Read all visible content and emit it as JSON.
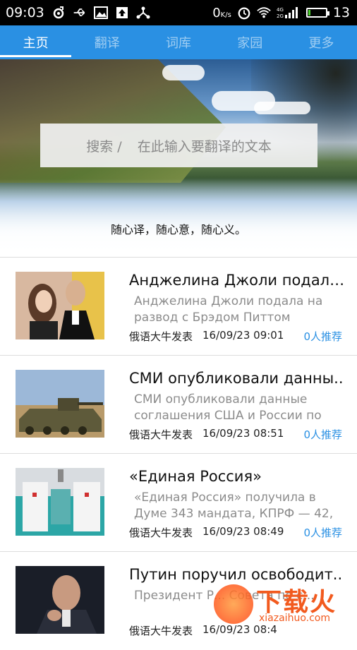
{
  "status_bar": {
    "time": "09:03",
    "net_speed": "0",
    "net_speed_unit": "K/s",
    "battery_level": "13",
    "icons": [
      "weibo-icon",
      "usb-icon",
      "image-icon",
      "upload-icon",
      "share-icon",
      "alarm-icon",
      "wifi-icon",
      "signal-icon",
      "battery-icon"
    ]
  },
  "tabs": [
    {
      "label": "主页",
      "active": true
    },
    {
      "label": "翻译",
      "active": false
    },
    {
      "label": "词库",
      "active": false
    },
    {
      "label": "家园",
      "active": false
    },
    {
      "label": "更多",
      "active": false
    }
  ],
  "hero": {
    "search_prefix": "搜索 /",
    "search_placeholder": "在此输入要翻译的文本",
    "slogan": "随心译，随心意，随心义。"
  },
  "news": [
    {
      "title": "Анджелина Джоли подала..",
      "summary": "Анджелина Джоли подала на развод с Брэдом Питтом",
      "source": "俄语大牛发表",
      "time": "16/09/23 09:01",
      "recommend": "0人推荐"
    },
    {
      "title": "СМИ опубликовали данны..",
      "summary": "СМИ опубликовали данные соглашения США и России по",
      "source": "俄语大牛发表",
      "time": "16/09/23 08:51",
      "recommend": "0人推荐"
    },
    {
      "title": "«Единая Россия»",
      "summary": "«Единая Россия» получила в Думе 343 мандата, КПРФ — 42,",
      "source": "俄语大牛发表",
      "time": "16/09/23 08:49",
      "recommend": "0人推荐"
    },
    {
      "title": "Путин поручил освободит..",
      "summary": "Президент Р... Совета по с...",
      "source": "俄语大牛发表",
      "time": "16/09/23 08:4",
      "recommend": ""
    }
  ],
  "watermark": {
    "text": "下载火",
    "url": "xiazaihuo.com"
  },
  "colors": {
    "accent": "#2a90e3",
    "status_bar": "#000000"
  }
}
